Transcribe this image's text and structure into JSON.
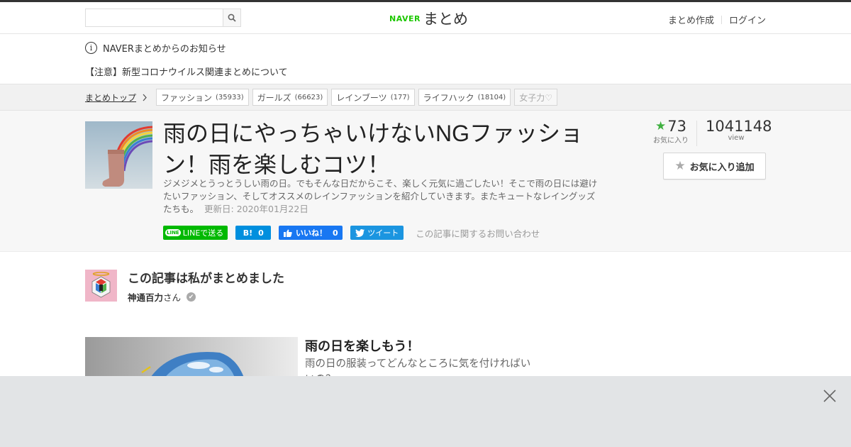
{
  "header": {
    "search_placeholder": "",
    "logo_naver": "NAVER",
    "logo_matome": "まとめ",
    "links": [
      "まとめ作成",
      "ログイン"
    ]
  },
  "notices": {
    "info": "NAVERまとめからのお知らせ",
    "item": "【注意】新型コロナウイルス関連まとめについて"
  },
  "breadcrumb": {
    "home": "まとめトップ",
    "tags": [
      {
        "label": "ファッション",
        "count": "(35933)"
      },
      {
        "label": "ガールズ",
        "count": "(66623)"
      },
      {
        "label": "レインブーツ",
        "count": "(177)"
      },
      {
        "label": "ライフハック",
        "count": "(18104)"
      },
      {
        "label": "女子力♡",
        "count": ""
      }
    ]
  },
  "article": {
    "title": "雨の日にやっちゃいけないNGファッション！雨を楽しむコツ！",
    "description": "ジメジメとうっとうしい雨の日。でもそんな日だからこそ、楽しく元気に過ごしたい！そこで雨の日には避けたいファッション、そしてオススメのレインファッションを紹介していきます。またキュートなレイングッズたちも。",
    "updated": "更新日: 2020年01月22日",
    "favorites": "73",
    "favorites_label": "お気に入り",
    "views": "1041148",
    "views_label": "view",
    "fav_button": "お気に入り追加"
  },
  "share": {
    "line_logo": "LINE",
    "line": "LINEで送る",
    "hatena": "B!",
    "hatena_count": "0",
    "facebook": "いいね！",
    "facebook_count": "0",
    "twitter": "ツイート",
    "inquiry": "この記事に関するお問い合わせ"
  },
  "author": {
    "heading": "この記事は私がまとめました",
    "name": "神通百力",
    "suffix": "さん"
  },
  "section": {
    "title": "雨の日を楽しもう！",
    "text": "雨の日の服装ってどんなところに気を付ければいいの？"
  },
  "colors": {
    "brand_green": "#1ec800",
    "star_green": "#3fb040",
    "line_green": "#00b900",
    "hatena_blue": "#008fde",
    "facebook_blue": "#1877f2",
    "twitter_blue": "#1b95e0"
  }
}
